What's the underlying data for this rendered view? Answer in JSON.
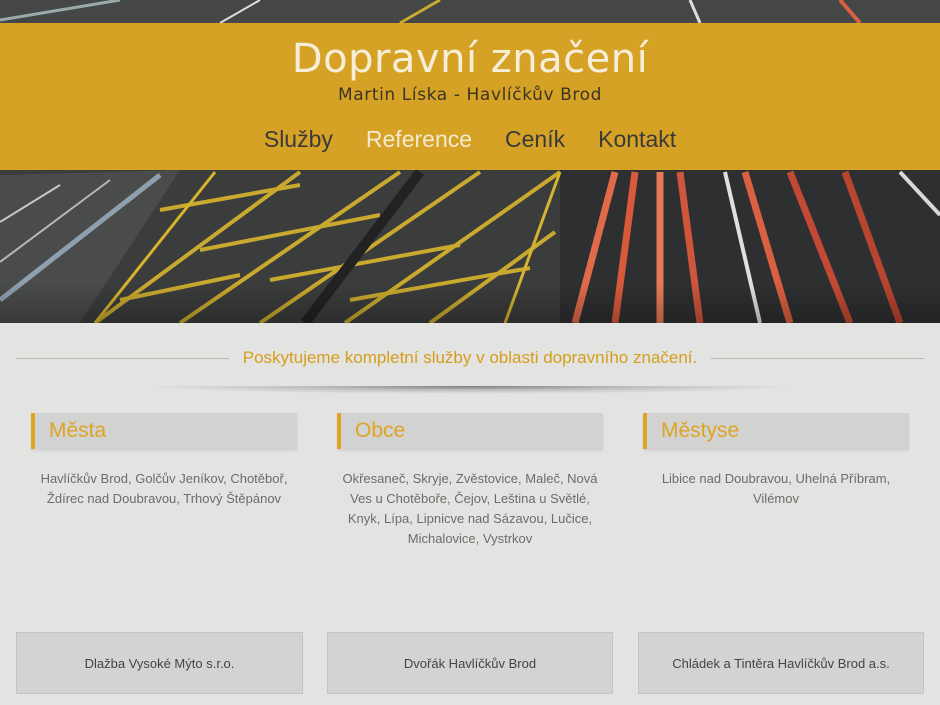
{
  "header": {
    "title": "Dopravní značení",
    "subtitle": "Martin Líska - Havlíčkův Brod"
  },
  "nav": {
    "items": [
      "Služby",
      "Reference",
      "Ceník",
      "Kontakt"
    ],
    "active": "Reference"
  },
  "tagline": "Poskytujeme kompletní služby v oblasti dopravního značení.",
  "columns": [
    {
      "heading": "Města",
      "text": "Havlíčkův Brod, Golčův Jeníkov, Chotěboř, Ždírec nad Doubravou, Trhový Štěpánov"
    },
    {
      "heading": "Obce",
      "text": "Okřesaneč, Skryje, Zvěstovice, Maleč, Nová Ves u Chotěboře, Čejov, Leština u Světlé, Knyk, Lípa, Lipnicve nad Sázavou, Lučice, Michalovice, Vystrkov"
    },
    {
      "heading": "Městyse",
      "text": "Libice nad Doubravou, Uhelná Příbram, Vilémov"
    }
  ],
  "references": [
    "Dlažba Vysoké Mýto s.r.o.",
    "Dvořák Havlíčkův Brod",
    "Chládek a Tintěra Havlíčkův Brod a.s."
  ],
  "colors": {
    "banner": "#e1aa23",
    "accent": "#dfa425",
    "background": "#e3e3e1"
  }
}
